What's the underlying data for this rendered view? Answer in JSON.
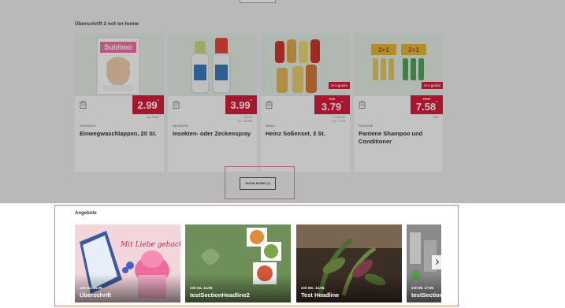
{
  "section_title": "Überschrift 2 not on home",
  "products": [
    {
      "brand": "Dresden",
      "name": "Einwegwaschlappen, 20 St.",
      "price": "2.99",
      "price_suffix": "*",
      "old_price": "",
      "badge": "",
      "note": "pro Pack."
    },
    {
      "brand": "Neuborn",
      "name": "Insekten- oder Zeckenspray",
      "price": "3.99",
      "price_suffix": "*",
      "old_price": "",
      "badge": "",
      "note": "100 ml\n(1l = 39.90)"
    },
    {
      "brand": "Heinz",
      "name": "Heinz Soßenset, 3 St.",
      "price": "3.79",
      "price_suffix": "*",
      "old_price": "5.69",
      "badge": "2+1 gratis",
      "note": "3 x 220 ml\n(1l = 5.74)"
    },
    {
      "brand": "Pantene",
      "name": "Pantene Shampoo und Conditioner",
      "price": "7.58",
      "price_suffix": "*",
      "old_price": "11.37",
      "badge": "2+1 gratis",
      "note": "Set"
    }
  ],
  "show_more_label": "SHOW MORE (7)",
  "angebote": {
    "title": "Angebote",
    "items": [
      {
        "date": "seit Sa. 16.06.",
        "headline": "Überschrift"
      },
      {
        "date": "seit Sa. 14.06.",
        "headline": "testSectionHeadline2"
      },
      {
        "date": "seit Mo. 13.06.",
        "headline": "Test Headline"
      },
      {
        "date": "seit Mi. 17.06.",
        "headline": "testSectionHeadline"
      }
    ]
  },
  "colors": {
    "accent_red": "#d50c2f",
    "highlight": "#e07a7a"
  }
}
